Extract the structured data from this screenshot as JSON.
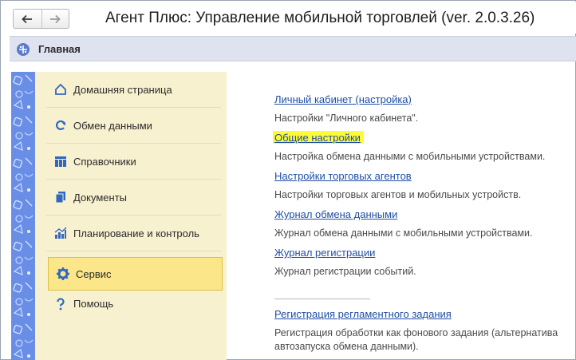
{
  "window": {
    "title": "Агент Плюс: Управление мобильной торговлей (ver. 2.0.3.26)"
  },
  "nav": {
    "back_icon": "arrow-left-icon",
    "forward_icon": "arrow-right-icon"
  },
  "section": {
    "title": "Главная",
    "icon": "main-section-icon"
  },
  "sidebar": {
    "items": [
      {
        "label": "Домашняя страница",
        "icon": "home-icon"
      },
      {
        "label": "Обмен данными",
        "icon": "sync-icon"
      },
      {
        "label": "Справочники",
        "icon": "catalog-icon"
      },
      {
        "label": "Документы",
        "icon": "documents-icon"
      },
      {
        "label": "Планирование и контроль",
        "icon": "chart-icon"
      },
      {
        "label": "Сервис",
        "icon": "gear-icon",
        "active": true
      },
      {
        "label": "Помощь",
        "icon": "help-icon"
      }
    ]
  },
  "content": {
    "items": [
      {
        "link": "Личный кабинет (настройка)",
        "desc": "Настройки \"Личного кабинета\"."
      },
      {
        "link": "Общие настройки",
        "desc": "Настройка обмена данными с мобильными устройствами.",
        "highlighted": true
      },
      {
        "link": "Настройки торговых агентов",
        "desc": "Настройки торговых агентов и мобильных устройств."
      },
      {
        "link": "Журнал обмена данными",
        "desc": "Журнал обмена данными с мобильными устройствами."
      },
      {
        "link": "Журнал регистрации",
        "desc": "Журнал регистрации событий."
      },
      {
        "link": "Регистрация регламентного задания",
        "desc": "Регистрация обработки как фонового задания (альтернатива автозапуска обмена данными)."
      }
    ]
  },
  "colors": {
    "accent_link": "#1f4ea6",
    "sidebar_bg": "#f8f1cf",
    "active_item": "#fbe68a",
    "highlight": "#fdfb36",
    "strip": "#6a8ee6"
  }
}
